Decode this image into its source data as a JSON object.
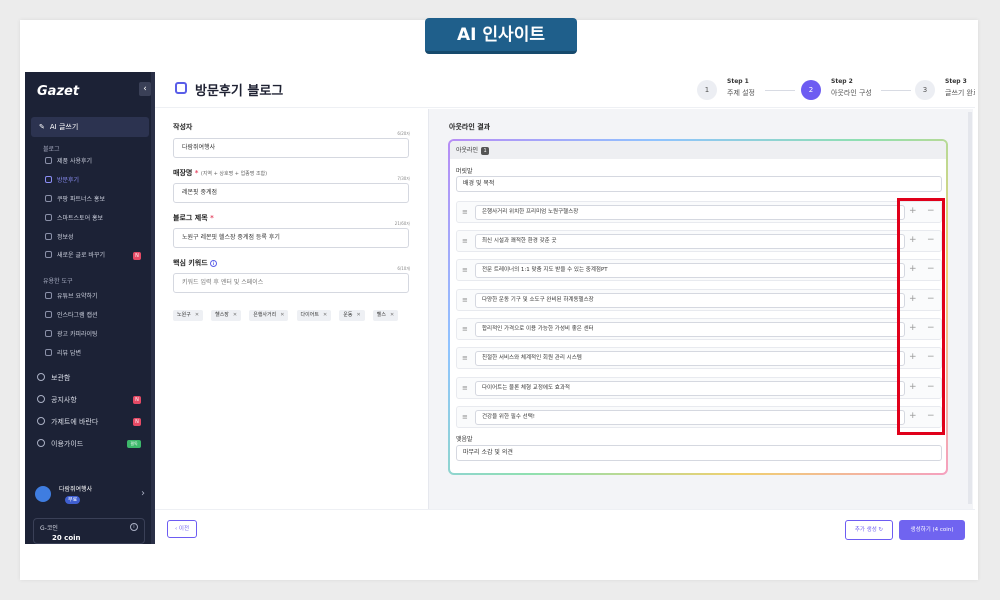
{
  "banner": "AI 인사이트",
  "sidebar": {
    "logo": "Gazet",
    "collapse_icon": "‹",
    "primary": "AI 글쓰기",
    "group_blog": "블로그",
    "blog_items": [
      {
        "label": "제품 사용후기",
        "active": false
      },
      {
        "label": "방문후기",
        "active": true
      },
      {
        "label": "쿠팡 파트너스 홍보",
        "active": false
      },
      {
        "label": "스마트스토어 홍보",
        "active": false
      },
      {
        "label": "정보성",
        "active": false
      },
      {
        "label": "새로운 글로 바꾸기",
        "active": false,
        "badge": "N"
      }
    ],
    "group_tools": "유용한 도구",
    "tool_items": [
      {
        "label": "유튜브 요약하기"
      },
      {
        "label": "인스타그램 캡션"
      },
      {
        "label": "광고 카피라이팅"
      },
      {
        "label": "리뷰 답변"
      }
    ],
    "main_items": [
      {
        "label": "보관함"
      },
      {
        "label": "공지사항",
        "badge": "N"
      },
      {
        "label": "가제트에 바란다",
        "badge": "N"
      },
      {
        "label": "이용가이드",
        "badge": "필독"
      }
    ],
    "user_name": "다람쥐여행사",
    "user_tag": "무료",
    "coin_label": "G-코인",
    "coin_value": "20 coin"
  },
  "header": {
    "title": "방문후기 블로그",
    "steps": [
      {
        "num": "Step 1",
        "label": "주제 설정",
        "circle": "1"
      },
      {
        "num": "Step 2",
        "label": "아웃라인 구성",
        "circle": "2"
      },
      {
        "num": "Step 3",
        "label": "글쓰기 완료",
        "circle": "3"
      }
    ]
  },
  "form": {
    "author_label": "작성자",
    "author_counter": "6/20자",
    "author_value": "다람쥐여행사",
    "store_label": "매장명",
    "store_hint": "(지역 + 상호명 + 업종명 조합)",
    "store_counter": "7/30자",
    "store_value": "레몬핏 중계점",
    "title_label": "블로그 제목",
    "title_counter": "21/60자",
    "title_value": "노원구 레몬핏 헬스장 중계점 등록 후기",
    "keyword_label": "핵심 키워드",
    "keyword_counter": "6/10개",
    "keyword_placeholder": "키워드 입력 후 엔터 및 스페이스",
    "tags": [
      "노원구",
      "헬스장",
      "은행사거리",
      "다이어트",
      "운동",
      "헬스"
    ]
  },
  "result": {
    "title": "아웃라인 결과",
    "outline_label": "아웃라인",
    "outline_count": "1",
    "intro_label": "머릿말",
    "intro_value": "배경 및 목적",
    "rows": [
      "은행사거리 위치한 프리미엄 노원구헬스장",
      "최신 시설과 쾌적한 환경 갖춘 곳",
      "전문 트레이너의 1:1 맞춤 지도 받을 수 있는 중계점PT",
      "다양한 운동 기구 및 소도구 완비된 하계동헬스장",
      "합리적인 가격으로 이용 가능한 가성비 좋은 센터",
      "친절한 서비스와 체계적인 회원 관리 시스템",
      "다이어트는 물론 체형 교정에도 효과적",
      "건강을 위한 필수 선택!"
    ],
    "outro_label": "맺음말",
    "outro_value": "마무리 소감 및 의견"
  },
  "footer": {
    "prev": "‹ 이전",
    "add_gen": "추가 생성 ↻",
    "generate": "생성하기 (4 coin)"
  },
  "colors": {
    "accent": "#6d5cf2",
    "highlight": "#e0001a",
    "sidebar_bg": "#1c2236",
    "banner_bg": "#1f5f8b"
  }
}
